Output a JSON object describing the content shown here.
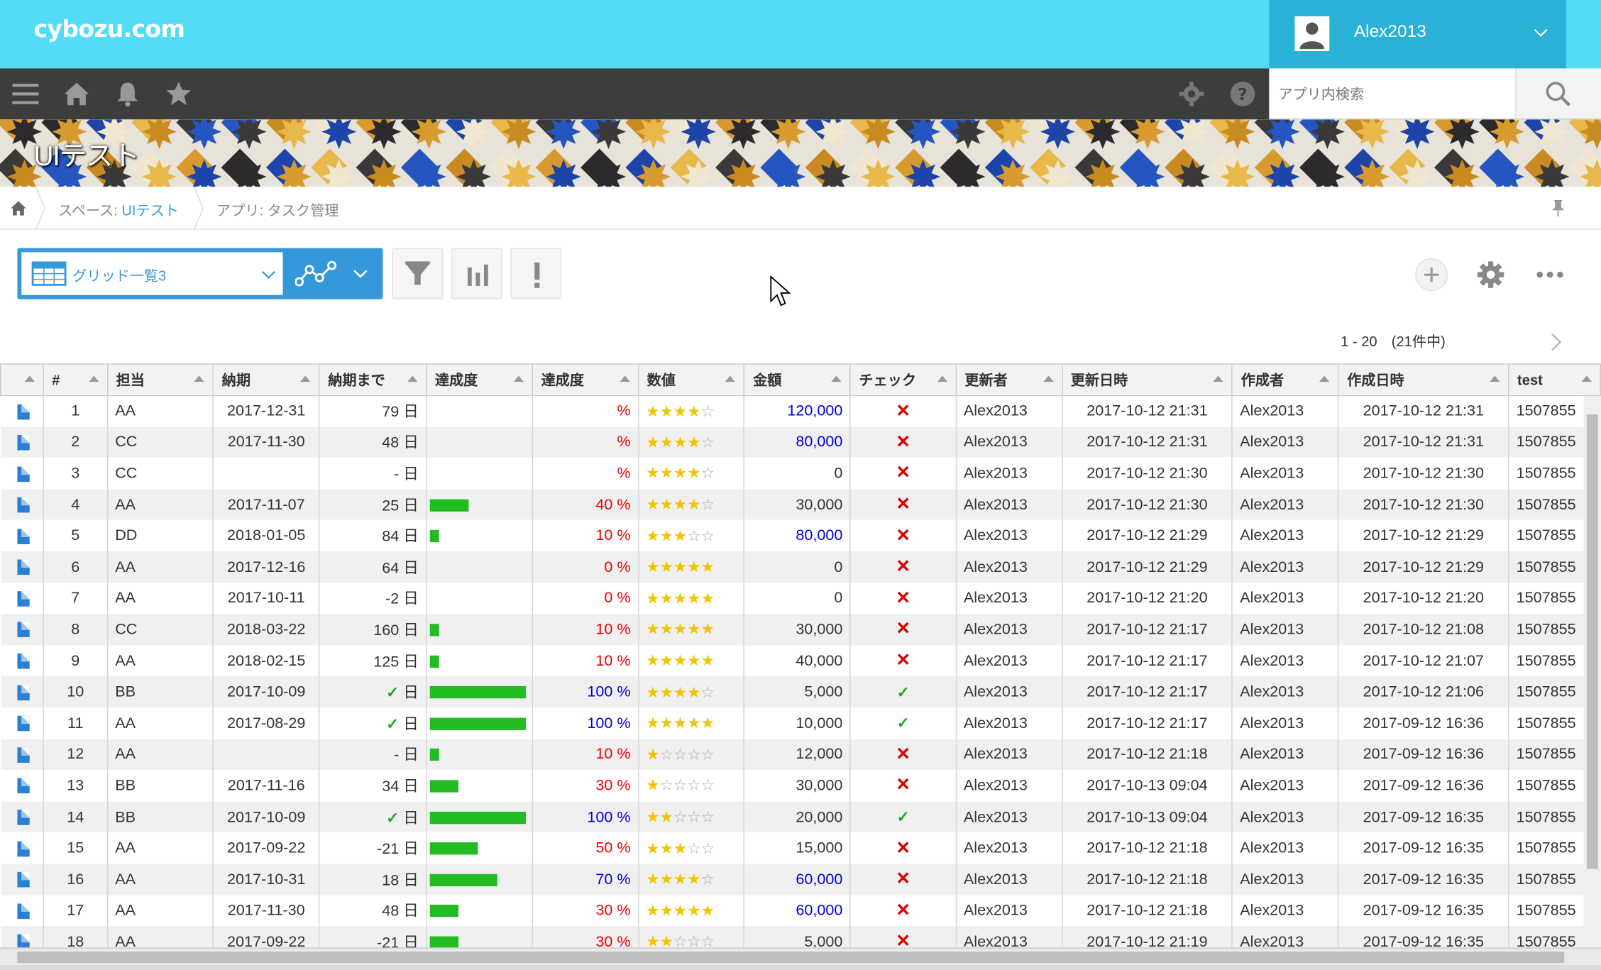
{
  "app": {
    "logo": "cybozu.com"
  },
  "user": {
    "name": "Alex2013"
  },
  "search": {
    "placeholder": "アプリ内検索"
  },
  "banner": {
    "title": "UIテスト"
  },
  "breadcrumb": {
    "space_prefix": "スペース: ",
    "space_link": "UIテスト",
    "app": "アプリ: タスク管理"
  },
  "toolbar": {
    "view_name": "グリッド一覧3"
  },
  "pager": {
    "text": "1 - 20　(21件中)"
  },
  "colors": {
    "header": "#52dcf8",
    "accent": "#3498db",
    "nav": "#3d3d3d",
    "bar": "#22bb22",
    "negative": "#dd0000"
  },
  "grid": {
    "headers": [
      "#",
      "担当",
      "納期",
      "納期まで",
      "達成度",
      "達成度",
      "数値",
      "金額",
      "チェック",
      "更新者",
      "更新日時",
      "作成者",
      "作成日時",
      "test"
    ],
    "rows": [
      {
        "num": "1",
        "owner": "AA",
        "due": "2017-12-31",
        "days": "79 日",
        "done": false,
        "progress": null,
        "pct": "%",
        "pct_color": "red",
        "stars": 4,
        "amount": "120,000",
        "amount_color": "blue",
        "check": false,
        "updater": "Alex2013",
        "updated": "2017-10-12 21:31",
        "creator": "Alex2013",
        "created": "2017-10-12 21:31",
        "test": "1507855"
      },
      {
        "num": "2",
        "owner": "CC",
        "due": "2017-11-30",
        "days": "48 日",
        "done": false,
        "progress": null,
        "pct": "%",
        "pct_color": "red",
        "stars": 4,
        "amount": "80,000",
        "amount_color": "blue",
        "check": false,
        "updater": "Alex2013",
        "updated": "2017-10-12 21:31",
        "creator": "Alex2013",
        "created": "2017-10-12 21:31",
        "test": "1507855"
      },
      {
        "num": "3",
        "owner": "CC",
        "due": "",
        "days": "- 日",
        "done": false,
        "progress": null,
        "pct": "%",
        "pct_color": "red",
        "stars": 4,
        "amount": "0",
        "amount_color": "black",
        "check": false,
        "updater": "Alex2013",
        "updated": "2017-10-12 21:30",
        "creator": "Alex2013",
        "created": "2017-10-12 21:30",
        "test": "1507855"
      },
      {
        "num": "4",
        "owner": "AA",
        "due": "2017-11-07",
        "days": "25 日",
        "done": false,
        "progress": 40,
        "pct": "40 %",
        "pct_color": "red",
        "stars": 4,
        "amount": "30,000",
        "amount_color": "black",
        "check": false,
        "updater": "Alex2013",
        "updated": "2017-10-12 21:30",
        "creator": "Alex2013",
        "created": "2017-10-12 21:30",
        "test": "1507855"
      },
      {
        "num": "5",
        "owner": "DD",
        "due": "2018-01-05",
        "days": "84 日",
        "done": false,
        "progress": 10,
        "pct": "10 %",
        "pct_color": "red",
        "stars": 3,
        "amount": "80,000",
        "amount_color": "blue",
        "check": false,
        "updater": "Alex2013",
        "updated": "2017-10-12 21:29",
        "creator": "Alex2013",
        "created": "2017-10-12 21:29",
        "test": "1507855"
      },
      {
        "num": "6",
        "owner": "AA",
        "due": "2017-12-16",
        "days": "64 日",
        "done": false,
        "progress": 0,
        "pct": "0 %",
        "pct_color": "red",
        "stars": 5,
        "amount": "0",
        "amount_color": "black",
        "check": false,
        "updater": "Alex2013",
        "updated": "2017-10-12 21:29",
        "creator": "Alex2013",
        "created": "2017-10-12 21:29",
        "test": "1507855"
      },
      {
        "num": "7",
        "owner": "AA",
        "due": "2017-10-11",
        "days": "-2 日",
        "done": false,
        "progress": 0,
        "pct": "0 %",
        "pct_color": "red",
        "stars": 5,
        "amount": "0",
        "amount_color": "black",
        "check": false,
        "updater": "Alex2013",
        "updated": "2017-10-12 21:20",
        "creator": "Alex2013",
        "created": "2017-10-12 21:20",
        "test": "1507855"
      },
      {
        "num": "8",
        "owner": "CC",
        "due": "2018-03-22",
        "days": "160 日",
        "done": false,
        "progress": 10,
        "pct": "10 %",
        "pct_color": "red",
        "stars": 5,
        "amount": "30,000",
        "amount_color": "black",
        "check": false,
        "updater": "Alex2013",
        "updated": "2017-10-12 21:17",
        "creator": "Alex2013",
        "created": "2017-10-12 21:08",
        "test": "1507855"
      },
      {
        "num": "9",
        "owner": "AA",
        "due": "2018-02-15",
        "days": "125 日",
        "done": false,
        "progress": 10,
        "pct": "10 %",
        "pct_color": "red",
        "stars": 5,
        "amount": "40,000",
        "amount_color": "black",
        "check": false,
        "updater": "Alex2013",
        "updated": "2017-10-12 21:17",
        "creator": "Alex2013",
        "created": "2017-10-12 21:07",
        "test": "1507855"
      },
      {
        "num": "10",
        "owner": "BB",
        "due": "2017-10-09",
        "days": "日",
        "done": true,
        "progress": 100,
        "pct": "100 %",
        "pct_color": "blue",
        "stars": 4,
        "amount": "5,000",
        "amount_color": "black",
        "check": true,
        "updater": "Alex2013",
        "updated": "2017-10-12 21:17",
        "creator": "Alex2013",
        "created": "2017-10-12 21:06",
        "test": "1507855"
      },
      {
        "num": "11",
        "owner": "AA",
        "due": "2017-08-29",
        "days": "日",
        "done": true,
        "progress": 100,
        "pct": "100 %",
        "pct_color": "blue",
        "stars": 5,
        "amount": "10,000",
        "amount_color": "black",
        "check": true,
        "updater": "Alex2013",
        "updated": "2017-10-12 21:17",
        "creator": "Alex2013",
        "created": "2017-09-12 16:36",
        "test": "1507855"
      },
      {
        "num": "12",
        "owner": "AA",
        "due": "",
        "days": "- 日",
        "done": false,
        "progress": 10,
        "pct": "10 %",
        "pct_color": "red",
        "stars": 1,
        "amount": "12,000",
        "amount_color": "black",
        "check": false,
        "updater": "Alex2013",
        "updated": "2017-10-12 21:18",
        "creator": "Alex2013",
        "created": "2017-09-12 16:36",
        "test": "1507855"
      },
      {
        "num": "13",
        "owner": "BB",
        "due": "2017-11-16",
        "days": "34 日",
        "done": false,
        "progress": 30,
        "pct": "30 %",
        "pct_color": "red",
        "stars": 1,
        "amount": "30,000",
        "amount_color": "black",
        "check": false,
        "updater": "Alex2013",
        "updated": "2017-10-13 09:04",
        "creator": "Alex2013",
        "created": "2017-09-12 16:36",
        "test": "1507855"
      },
      {
        "num": "14",
        "owner": "BB",
        "due": "2017-10-09",
        "days": "日",
        "done": true,
        "progress": 100,
        "pct": "100 %",
        "pct_color": "blue",
        "stars": 2,
        "amount": "20,000",
        "amount_color": "black",
        "check": true,
        "updater": "Alex2013",
        "updated": "2017-10-13 09:04",
        "creator": "Alex2013",
        "created": "2017-09-12 16:35",
        "test": "1507855"
      },
      {
        "num": "15",
        "owner": "AA",
        "due": "2017-09-22",
        "days": "-21 日",
        "done": false,
        "progress": 50,
        "pct": "50 %",
        "pct_color": "red",
        "stars": 3,
        "amount": "15,000",
        "amount_color": "black",
        "check": false,
        "updater": "Alex2013",
        "updated": "2017-10-12 21:18",
        "creator": "Alex2013",
        "created": "2017-09-12 16:35",
        "test": "1507855"
      },
      {
        "num": "16",
        "owner": "AA",
        "due": "2017-10-31",
        "days": "18 日",
        "done": false,
        "progress": 70,
        "pct": "70 %",
        "pct_color": "blue",
        "stars": 4,
        "amount": "60,000",
        "amount_color": "blue",
        "check": false,
        "updater": "Alex2013",
        "updated": "2017-10-12 21:18",
        "creator": "Alex2013",
        "created": "2017-09-12 16:35",
        "test": "1507855"
      },
      {
        "num": "17",
        "owner": "AA",
        "due": "2017-11-30",
        "days": "48 日",
        "done": false,
        "progress": 30,
        "pct": "30 %",
        "pct_color": "red",
        "stars": 5,
        "amount": "60,000",
        "amount_color": "blue",
        "check": false,
        "updater": "Alex2013",
        "updated": "2017-10-12 21:18",
        "creator": "Alex2013",
        "created": "2017-09-12 16:35",
        "test": "1507855"
      },
      {
        "num": "18",
        "owner": "AA",
        "due": "2017-09-22",
        "days": "-21 日",
        "done": false,
        "progress": 30,
        "pct": "30 %",
        "pct_color": "red",
        "stars": 2,
        "amount": "5,000",
        "amount_color": "black",
        "check": false,
        "updater": "Alex2013",
        "updated": "2017-10-12 21:19",
        "creator": "Alex2013",
        "created": "2017-09-12 16:35",
        "test": "1507855"
      }
    ]
  }
}
